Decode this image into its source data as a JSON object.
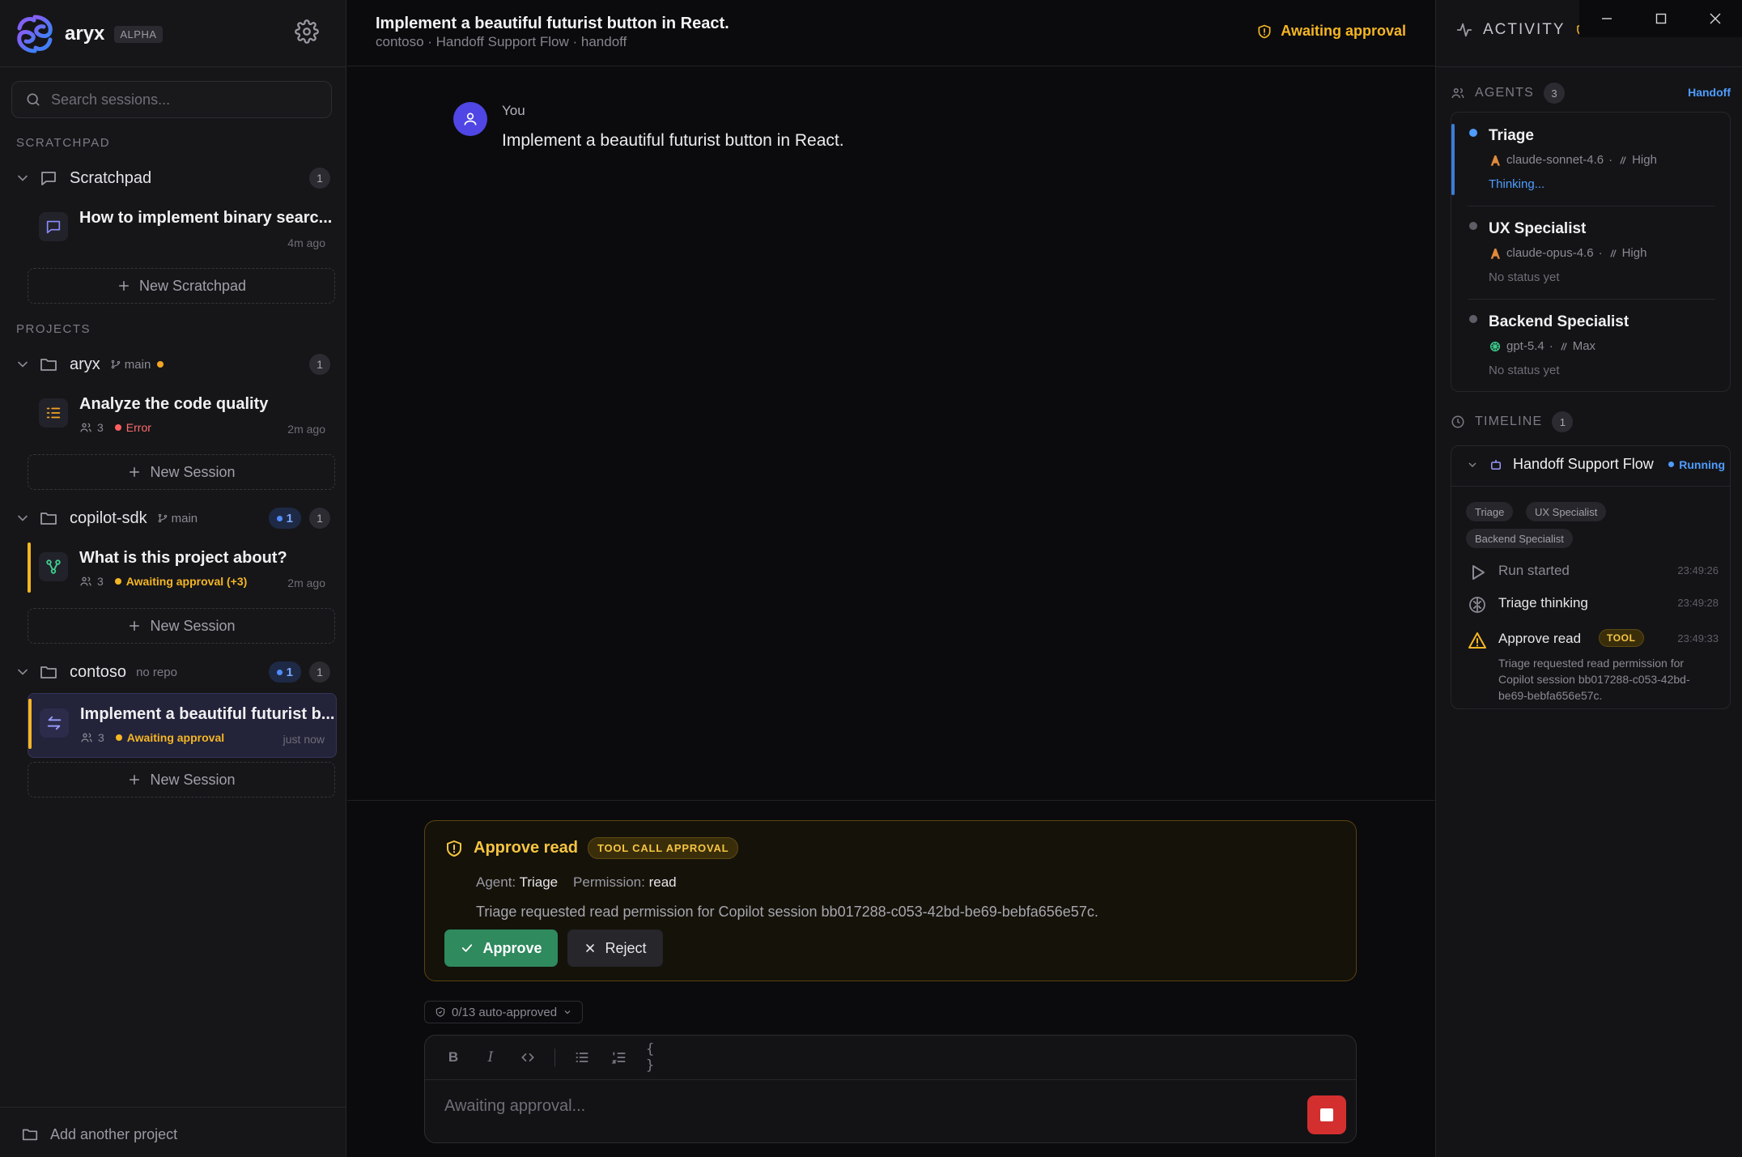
{
  "app": {
    "name": "aryx",
    "badge": "ALPHA"
  },
  "search": {
    "placeholder": "Search sessions..."
  },
  "sidebar": {
    "scratchpad_section": "SCRATCHPAD",
    "scratchpad_group": {
      "name": "Scratchpad",
      "count": "1"
    },
    "scratchpad_session": {
      "title": "How to implement binary searc...",
      "time": "4m ago"
    },
    "new_scratchpad": "New Scratchpad",
    "projects_section": "PROJECTS",
    "projects": [
      {
        "name": "aryx",
        "branch": "main",
        "count": "1",
        "session": {
          "title": "Analyze the code quality",
          "agents": "3",
          "status": "Error",
          "time": "2m ago"
        },
        "new_label": "New Session"
      },
      {
        "name": "copilot-sdk",
        "branch": "main",
        "count": "1",
        "running": "1",
        "session": {
          "title": "What is this project about?",
          "agents": "3",
          "status": "Awaiting approval (+3)",
          "time": "2m ago"
        },
        "new_label": "New Session"
      },
      {
        "name": "contoso",
        "repo": "no repo",
        "count": "1",
        "running": "1",
        "session": {
          "title": "Implement a beautiful futurist b...",
          "agents": "3",
          "status": "Awaiting approval",
          "time": "just now"
        },
        "new_label": "New Session"
      }
    ],
    "add_project": "Add another project"
  },
  "header": {
    "title": "Implement a beautiful futurist button in React.",
    "subtitle": "contoso · Handoff Support Flow · handoff",
    "status": "Awaiting approval"
  },
  "conversation": {
    "author": "You",
    "message": "Implement a beautiful futurist button in React."
  },
  "approval": {
    "title": "Approve read",
    "badge": "TOOL CALL APPROVAL",
    "agent_label": "Agent:",
    "agent": "Triage",
    "permission_label": "Permission:",
    "permission": "read",
    "description": "Triage requested read permission for Copilot session bb017288-c053-42bd-be69-bebfa656e57c.",
    "approve_label": "Approve",
    "reject_label": "Reject"
  },
  "auto_approved": "0/13 auto-approved",
  "composer": {
    "placeholder": "Awaiting approval..."
  },
  "activity": {
    "title": "ACTIVITY",
    "agents_label": "AGENTS",
    "agents_count": "3",
    "mode_link": "Handoff",
    "agents": [
      {
        "name": "Triage",
        "model": "claude-sonnet-4.6",
        "effort": "High",
        "status": "Thinking...",
        "dot_color": "#4f9dff"
      },
      {
        "name": "UX Specialist",
        "model": "claude-opus-4.6",
        "effort": "High",
        "status": "No status yet",
        "dot_color": "#5e5e67"
      },
      {
        "name": "Backend Specialist",
        "model": "gpt-5.4",
        "effort": "Max",
        "status": "No status yet",
        "dot_color": "#5e5e67"
      }
    ],
    "timeline_label": "TIMELINE",
    "timeline_count": "1",
    "flow": {
      "name": "Handoff Support Flow",
      "state": "Running",
      "chips": [
        "Triage",
        "UX Specialist",
        "Backend Specialist"
      ],
      "events": [
        {
          "title": "Run started",
          "time": "23:49:26",
          "icon": "play-icon"
        },
        {
          "title": "Triage thinking",
          "time": "23:49:28",
          "icon": "brain-icon"
        },
        {
          "title": "Approve read",
          "badge": "TOOL",
          "time": "23:49:33",
          "icon": "warning-icon",
          "description": "Triage requested read permission for Copilot session bb017288-c053-42bd-be69-bebfa656e57c."
        }
      ]
    }
  }
}
